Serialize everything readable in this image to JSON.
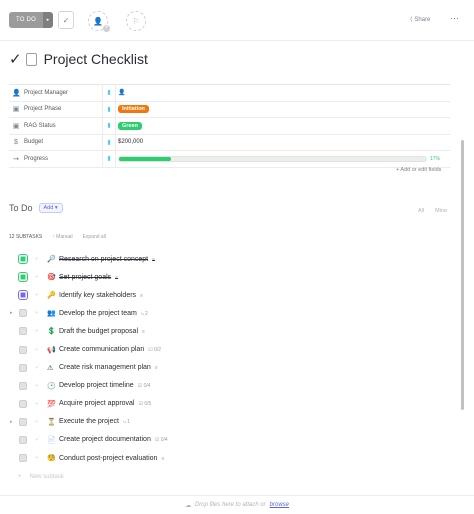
{
  "topbar": {
    "status_label": "TO DO",
    "status_arrow": "▸",
    "check_glyph": "✓",
    "assignee_glyph": "👤",
    "plus_glyph": "+",
    "flag_glyph": "⚐",
    "share_icon": "⟨",
    "share_label": "Share",
    "menu_glyph": "⋯"
  },
  "title": {
    "check": "✓",
    "text": "Project Checklist"
  },
  "fields": [
    {
      "icon": "👤",
      "name": "Project Manager",
      "info": "▮",
      "value": "👤",
      "type": "avatar"
    },
    {
      "icon": "▣",
      "name": "Project Phase",
      "info": "▮",
      "value": "Initiation",
      "type": "pill",
      "color": "#f1780e"
    },
    {
      "icon": "▣",
      "name": "RAG Status",
      "info": "▮",
      "value": "Green",
      "type": "pill",
      "color": "#2ecd6f"
    },
    {
      "icon": "$",
      "name": "Budget",
      "info": "▮",
      "value": "$200,000",
      "type": "text"
    },
    {
      "icon": "⇝",
      "name": "Progress",
      "info": "▮",
      "value": "17%",
      "type": "progress",
      "progress": 0.17
    }
  ],
  "add_fields_label": "+ Add or edit fields",
  "todo": {
    "heading": "To Do",
    "add_label": "Add ▾",
    "filter_all": "All",
    "filter_mine": "Mine"
  },
  "subtasks_bar": {
    "count": "12 SUBTASKS",
    "sort": "↑ Manual",
    "expand": "Expand all"
  },
  "tasks": [
    {
      "name": "Research on project concept",
      "emoji": "🔎",
      "status_color": "#2ecd6f",
      "done": true,
      "meta": "≡",
      "expand": ""
    },
    {
      "name": "Set project goals",
      "emoji": "🎯",
      "status_color": "#2ecd6f",
      "done": true,
      "meta": "≡",
      "expand": ""
    },
    {
      "name": "Identify key stakeholders",
      "emoji": "🔑",
      "status_color": "#7b68ee",
      "done": false,
      "meta": "≡",
      "expand": ""
    },
    {
      "name": "Develop the project team",
      "emoji": "👥",
      "status_color": "#d3d3d3",
      "done": false,
      "meta": "⤷ 2",
      "expand": "▸"
    },
    {
      "name": "Draft the budget proposal",
      "emoji": "💲",
      "status_color": "#d3d3d3",
      "done": false,
      "meta": "≡",
      "expand": ""
    },
    {
      "name": "Create communication plan",
      "emoji": "📢",
      "status_color": "#d3d3d3",
      "done": false,
      "meta": "☑ 0/2",
      "expand": ""
    },
    {
      "name": "Create risk management plan",
      "emoji": "⚠",
      "status_color": "#d3d3d3",
      "done": false,
      "meta": "≡",
      "expand": ""
    },
    {
      "name": "Develop project timeline",
      "emoji": "🕑",
      "status_color": "#d3d3d3",
      "done": false,
      "meta": "☑ 0/4",
      "expand": ""
    },
    {
      "name": "Acquire project approval",
      "emoji": "💯",
      "status_color": "#d3d3d3",
      "done": false,
      "meta": "☑ 0/5",
      "expand": ""
    },
    {
      "name": "Execute the project",
      "emoji": "⏳",
      "status_color": "#d3d3d3",
      "done": false,
      "meta": "⤷ 1",
      "expand": "▸"
    },
    {
      "name": "Create project documentation",
      "emoji": "📄",
      "status_color": "#d3d3d3",
      "done": false,
      "meta": "☑ 0/4",
      "expand": ""
    },
    {
      "name": "Conduct post-project evaluation",
      "emoji": "🧐",
      "status_color": "#d3d3d3",
      "done": false,
      "meta": "≡",
      "expand": ""
    }
  ],
  "new_subtask": {
    "plus": "+",
    "label": "New subtask"
  },
  "dropzone": {
    "icon": "☁",
    "text": "Drop files here to attach or",
    "link": "browse"
  }
}
